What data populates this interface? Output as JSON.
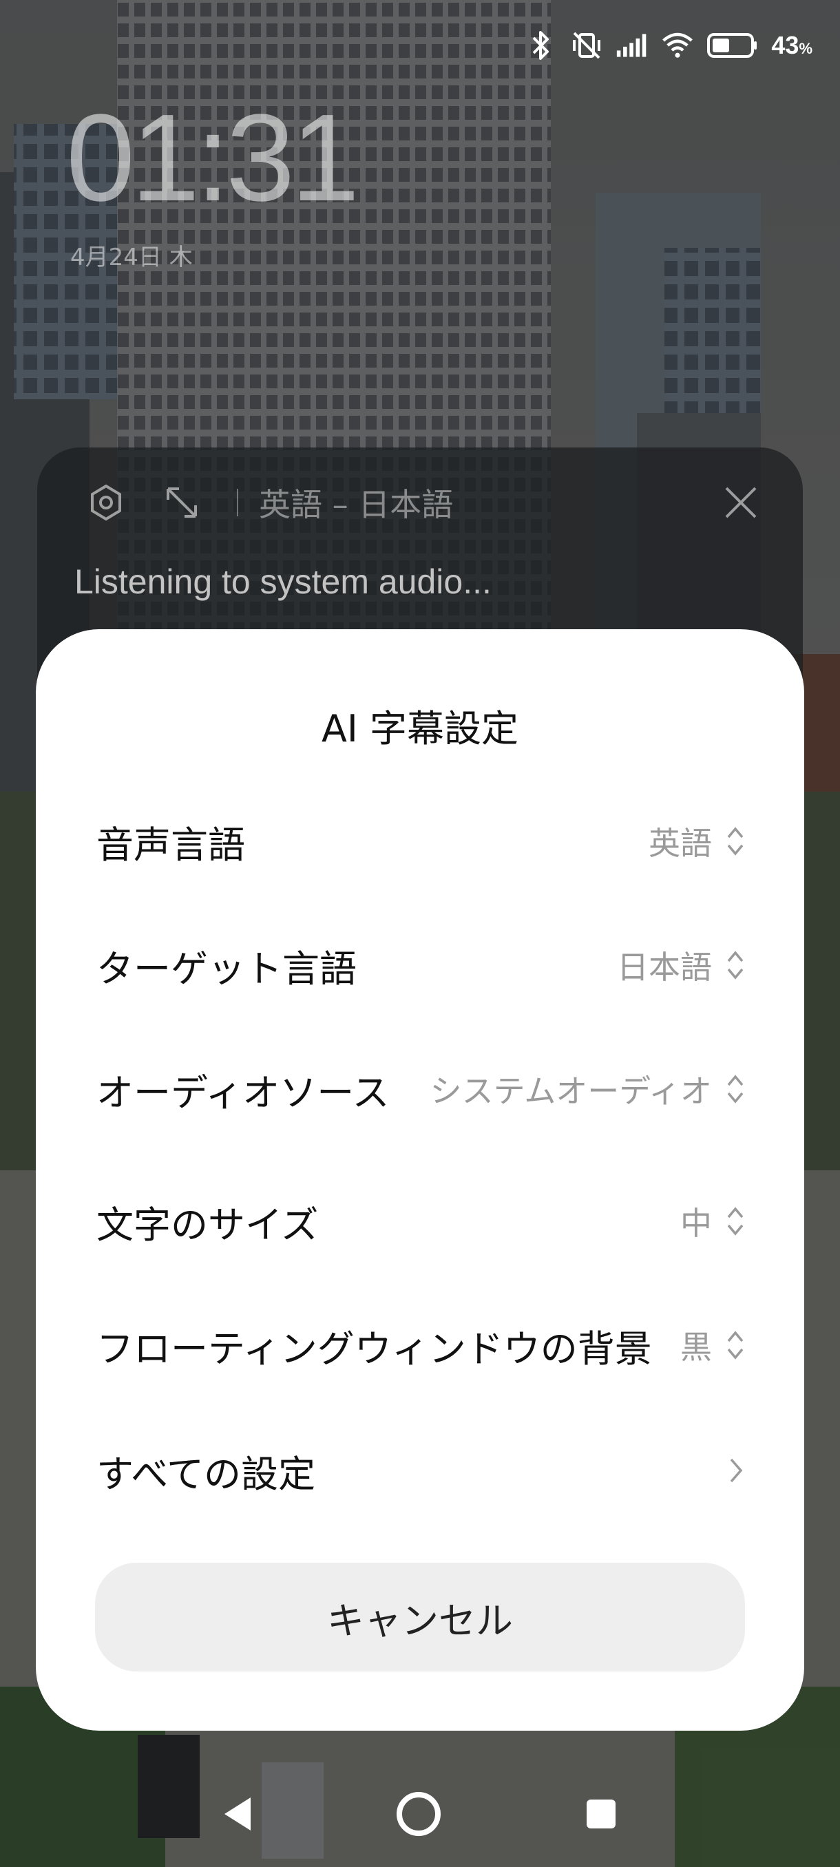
{
  "status_bar": {
    "icons": [
      "bluetooth-icon",
      "vibrate-off-icon",
      "signal-icon",
      "wifi-icon",
      "battery-icon"
    ],
    "battery_value": "43",
    "battery_unit": "%"
  },
  "lockscreen": {
    "time": "01:31",
    "date": "4月24日 木"
  },
  "floating_window": {
    "language_pair": "英語 – 日本語",
    "status_text": "Listening to system audio...",
    "icons": [
      "settings-icon",
      "expand-icon",
      "close-icon"
    ]
  },
  "dialog": {
    "title": "AI 字幕設定",
    "rows": [
      {
        "label": "音声言語",
        "value": "英語",
        "icon": "chevron-updown-icon"
      },
      {
        "label": "ターゲット言語",
        "value": "日本語",
        "icon": "chevron-updown-icon"
      },
      {
        "label": "オーディオソース",
        "value": "システムオーディオ",
        "icon": "chevron-updown-icon"
      },
      {
        "label": "文字のサイズ",
        "value": "中",
        "icon": "chevron-updown-icon"
      },
      {
        "label": "フローティングウィンドウの背景",
        "value": "黒",
        "icon": "chevron-updown-icon"
      },
      {
        "label": "すべての設定",
        "value": "",
        "icon": "chevron-right-icon"
      }
    ],
    "cancel_label": "キャンセル"
  },
  "nav_bar": {
    "buttons": [
      "back-icon",
      "home-icon",
      "recents-icon"
    ]
  }
}
